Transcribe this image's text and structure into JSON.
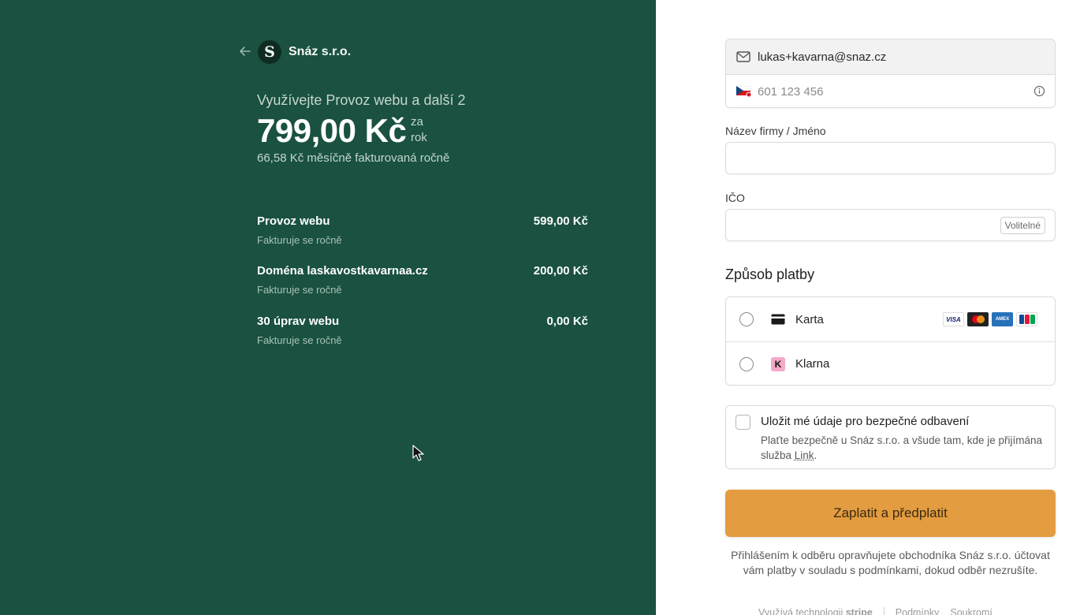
{
  "merchant": {
    "name": "Snáz s.r.o.",
    "logo_letter": "S"
  },
  "summary": {
    "plan_title": "Využívejte Provoz webu a další 2",
    "price": "799,00 Kč",
    "period_line1": "za",
    "period_line2": "rok",
    "monthly": "66,58 Kč měsíčně fakturovaná ročně"
  },
  "items": [
    {
      "name": "Provoz webu",
      "sub": "Fakturuje se ročně",
      "price": "599,00 Kč"
    },
    {
      "name": "Doména laskavostkavarnaa.cz",
      "sub": "Fakturuje se ročně",
      "price": "200,00 Kč"
    },
    {
      "name": "30 úprav webu",
      "sub": "Fakturuje se ročně",
      "price": "0,00 Kč"
    }
  ],
  "contact": {
    "email": "lukas+kavarna@snaz.cz",
    "phone_placeholder": "601 123 456",
    "phone_value": ""
  },
  "form": {
    "company_label": "Název firmy / Jméno",
    "company_value": "",
    "ico_label": "IČO",
    "ico_value": "",
    "optional_badge": "Volitelné"
  },
  "payment": {
    "title": "Způsob platby",
    "options": [
      {
        "label": "Karta",
        "selected": false
      },
      {
        "label": "Klarna",
        "selected": false
      }
    ],
    "card_brands": [
      "VISA",
      "Mastercard",
      "AMEX",
      "JCB"
    ]
  },
  "save": {
    "title": "Uložit mé údaje pro bezpečné odbavení",
    "desc_before": "Plaťte bezpečně u Snáz s.r.o. a všude tam, kde je přijímána služba ",
    "link": "Link",
    "desc_after": ".",
    "checked": false
  },
  "submit_label": "Zaplatit a předplatit",
  "legal": "Přihlášením k odběru opravňujete obchodníka Snáz s.r.o. účtovat vám platby v souladu s podmínkami, dokud odběr nezrušíte.",
  "footer": {
    "powered": "Využívá technologii",
    "stripe": "stripe",
    "terms": "Podmínky",
    "privacy": "Soukromí"
  },
  "colors": {
    "left_bg": "#1a5141",
    "button_bg": "#e49c40",
    "klarna_pink": "#f4a9c8"
  }
}
